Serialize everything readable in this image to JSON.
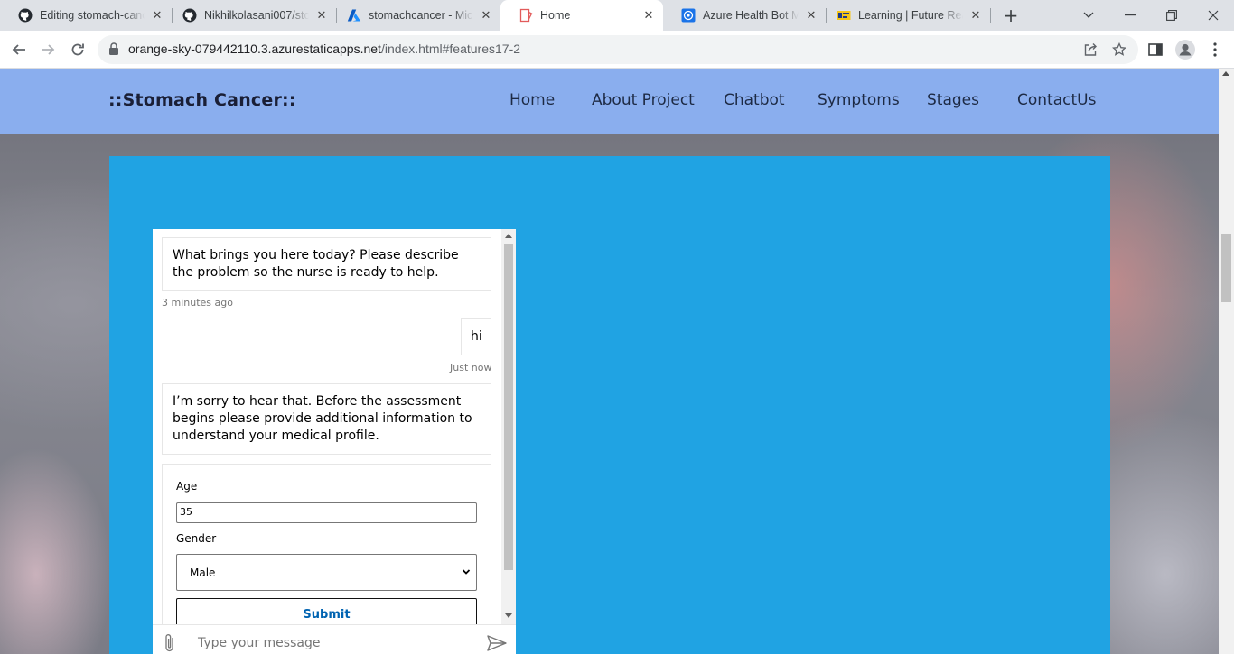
{
  "browser": {
    "tabs": [
      {
        "title": "Editing stomach-cancer",
        "icon": "github-icon",
        "active": false
      },
      {
        "title": "Nikhilkolasani007/stomach",
        "icon": "github-icon",
        "active": false
      },
      {
        "title": "stomachcancer - Microsoft Azure",
        "icon": "azure-icon",
        "active": false
      },
      {
        "title": "Home",
        "icon": "page-icon",
        "active": true
      },
      {
        "title": "Azure Health Bot Management",
        "icon": "healthbot-icon",
        "active": false
      },
      {
        "title": "Learning | Future Ready",
        "icon": "learning-icon",
        "active": false
      }
    ],
    "url_host": "orange-sky-079442110.3.azurestaticapps.net",
    "url_path": "/index.html#features17-2"
  },
  "site": {
    "brand": "::Stomach Cancer::",
    "nav": [
      "Home",
      "About Project",
      "Chatbot",
      "Symptoms",
      "Stages",
      "ContactUs"
    ]
  },
  "chat": {
    "messages": [
      {
        "from": "bot",
        "text": "What brings you here today? Please describe the problem so the nurse is ready to help.",
        "time": "3 minutes ago"
      },
      {
        "from": "user",
        "text": "hi",
        "time": "Just now"
      },
      {
        "from": "bot",
        "text": "I’m sorry to hear that. Before the assessment begins please provide additional information to understand your medical profile."
      }
    ],
    "form": {
      "age_label": "Age",
      "age_value": "35",
      "gender_label": "Gender",
      "gender_value": "Male",
      "submit_label": "Submit"
    },
    "input_placeholder": "Type your message"
  },
  "colors": {
    "header": "#8aaeee",
    "panel": "#20a3e3",
    "submit_text": "#0063b1"
  }
}
